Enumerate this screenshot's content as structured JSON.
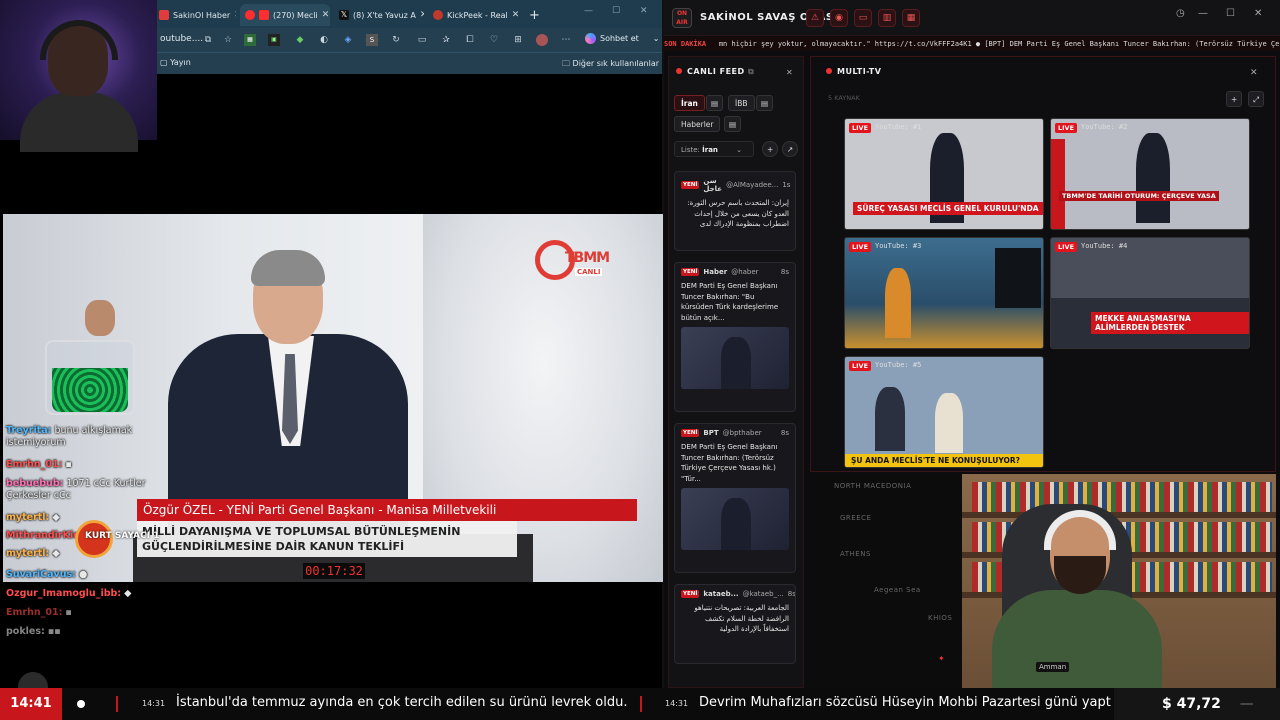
{
  "browser": {
    "tabs": [
      {
        "label": "SakinOl Haber",
        "color": "#e23b3b"
      },
      {
        "label": "(270) Mecli",
        "color": "#ff2d2d"
      },
      {
        "label": "(8) X'te Yavuz A",
        "color": "#111111"
      },
      {
        "label": "KickPeek - Real",
        "color": "#c0392b"
      }
    ],
    "url": "outube....",
    "copilot_label": "Sohbet et",
    "bookmarks": [
      "Yayın",
      "Diğer sık kullanılanlar"
    ]
  },
  "video": {
    "channel_logo": "TBMM",
    "channel_sub": "CANLI",
    "lower_third_name": "Özgür ÖZEL - YENİ Parti Genel Başkanı - Manisa Milletvekili",
    "lower_third_line1": "MİLLİ DAYANIŞMA VE TOPLUMSAL BÜTÜNLEŞMENİN",
    "lower_third_line2": "GÜÇLENDİRİLMESİNE DAİR KANUN TEKLİFİ",
    "clock": "00:17:32"
  },
  "chat": [
    {
      "user": "Treyrita:",
      "text": "bunu alkışlamak istemiyorum",
      "color": "#4db8ff"
    },
    {
      "user": "Emrhn_01:",
      "text": "",
      "color": "#ff4d4d"
    },
    {
      "user": "bebuebub:",
      "text": "1071 cCc Kurtler Çerkesler cCc",
      "color": "#ff6fb1"
    },
    {
      "user": "mytertl:",
      "text": "",
      "color": "#ffb347"
    },
    {
      "user": "MithrandirKick:",
      "text": "",
      "color": "#ff4d4d"
    },
    {
      "user": "mytertl:",
      "text": "",
      "color": "#ffb347"
    },
    {
      "user": "SuvariCavus:",
      "text": "",
      "color": "#4db8ff"
    },
    {
      "user": "Ozgur_Imamoglu_ibb:",
      "text": "",
      "color": "#ff4d4d"
    },
    {
      "user": "Emrhn_01:",
      "text": "",
      "color": "#ff4d4d"
    },
    {
      "user": "pokles:",
      "text": "",
      "color": "#dddddd"
    }
  ],
  "kurt_sayaci": "KURT SAYACI 1",
  "dashboard": {
    "title": "SAKİNOL SAVAŞ ODASI",
    "ticker_label": "SON DAKİKA",
    "ticker_text": "mn hiçbir şey yoktur, olmayacaktır.\" https://t.co/VkFFF2a4K1  ●  [BPT] DEM Parti Eş Genel Başkanı Tuncer Bakırhan: (Terörsüz Türkiye Çerçe",
    "feed_title": "CANLI FEED",
    "feed_chips": [
      "İran",
      "İBB",
      "Haberler"
    ],
    "list_label": "Liste:",
    "list_value": "İran",
    "cards": [
      {
        "badge": "YENİ",
        "source": "سن عاجل",
        "handle": "@AlMayadee...",
        "time": "1s",
        "body": "إيران: المتحدث باسم حرس الثورة: العدو كان يسعى من خلال إحداث اضطراب بمنظومة الإدراك لدى",
        "rtl": true
      },
      {
        "badge": "YENİ",
        "source": "Haber",
        "handle": "@haber",
        "time": "8s",
        "body": "DEM Parti Eş Genel Başkanı Tuncer Bakırhan: \"Bu kürsüden Türk kardeşlerime bütün açık...",
        "rtl": false
      },
      {
        "badge": "YENİ",
        "source": "BPT",
        "handle": "@bpthaber",
        "time": "8s",
        "body": "DEM Parti Eş Genel Başkanı Tuncer Bakırhan: (Terörsüz Türkiye Çerçeve Yasası hk.) \"Tür...",
        "rtl": false
      },
      {
        "badge": "YENİ",
        "source": "kataeb...",
        "handle": "@kataeb_...",
        "time": "8s",
        "body": "الجامعة العربية: تصريحات نتنياهو الرافضة لخطة السلام تكشف استخفافاً بالإرادة الدولية",
        "rtl": true
      }
    ],
    "mtv_title": "MULTI-TV",
    "mtv_sub": "5 KAYNAK",
    "tiles": [
      {
        "live": "LIVE",
        "label": "YouTube: #1",
        "caption": "SÜREÇ YASASI MECLİS GENEL KURULU'NDA",
        "style": "red",
        "bg": "#c7c9cf"
      },
      {
        "live": "LIVE",
        "label": "YouTube: #2",
        "caption": "TBMM'DE TARİHİ OTURUM: ÇERÇEVE YASA",
        "style": "red",
        "bg": "#b9bcc4"
      },
      {
        "live": "LIVE",
        "label": "YouTube: #3",
        "caption": "",
        "style": "none",
        "bg": "#2d5a7a"
      },
      {
        "live": "LIVE",
        "label": "YouTube: #4",
        "caption": "MEKKE ANLAŞMASI'NA ALİMLERDEN DESTEK",
        "style": "red",
        "bg": "#4a4e5a"
      },
      {
        "live": "LIVE",
        "label": "YouTube: #5",
        "caption": "ŞU ANDA MECLİS'TE NE KONUŞULUYOR?",
        "style": "yellow",
        "bg": "#8aa0b8"
      }
    ],
    "map_labels": [
      "NORTH MACEDONIA",
      "GREECE",
      "ATHENS",
      "Aegean Sea",
      "KHIOS",
      "Amman"
    ]
  },
  "bottom_bar": {
    "time": "14:41",
    "items": [
      {
        "ts": "14:31",
        "text": "İstanbul'da temmuz ayında en çok tercih edilen su ürünü levrek oldu."
      },
      {
        "ts": "14:31",
        "text": "Devrim Muhafızları sözcüsü Hüseyin Mohbi Pazartesi günü yapt"
      }
    ],
    "price": "$ 47,72",
    "price_dash": "—"
  }
}
